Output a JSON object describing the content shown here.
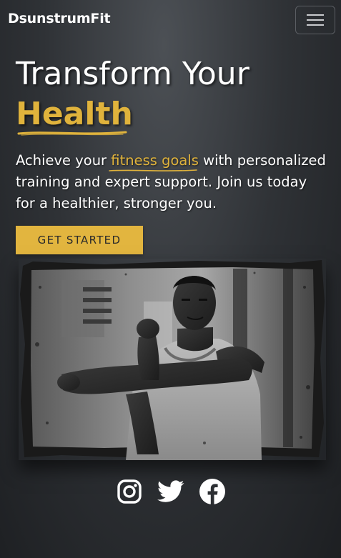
{
  "navbar": {
    "brand": "DsunstrumFit",
    "toggler_icon": "hamburger-menu-icon"
  },
  "hero": {
    "title_line1": "Transform Your",
    "title_accent": "Health",
    "text_before": "Achieve your ",
    "text_highlight": "fitness goals",
    "text_after": " with personalized training and expert support. Join us today for a healthier, stronger you.",
    "cta_label": "GET STARTED",
    "image_subject": "man-stretching-arm-photo"
  },
  "socials": [
    {
      "icon": "instagram-icon"
    },
    {
      "icon": "twitter-icon"
    },
    {
      "icon": "facebook-icon"
    }
  ],
  "colors": {
    "accent": "#e2b53f",
    "background": "#2f3236",
    "text": "#ffffff"
  }
}
